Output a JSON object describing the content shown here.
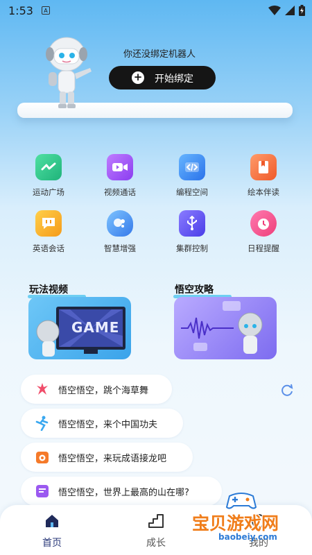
{
  "status_bar": {
    "time": "1:53",
    "a_glyph": "A"
  },
  "header": {
    "hint": "你还没绑定机器人",
    "bind_button": "开始绑定"
  },
  "features": [
    {
      "label": "运动广场",
      "icon": "pulse-icon",
      "color": "#2fc98a"
    },
    {
      "label": "视频通话",
      "icon": "video-icon",
      "color": "#9b59f0"
    },
    {
      "label": "编程空间",
      "icon": "code-icon",
      "color": "#3b8ef5"
    },
    {
      "label": "绘本伴读",
      "icon": "book-icon",
      "color": "#f5693a"
    },
    {
      "label": "英语会话",
      "icon": "chat-icon",
      "color": "#f5a623"
    },
    {
      "label": "智慧增强",
      "icon": "brain-icon",
      "color": "#3b8ef5"
    },
    {
      "label": "集群控制",
      "icon": "usb-icon",
      "color": "#6a5cf5"
    },
    {
      "label": "日程提醒",
      "icon": "alarm-icon",
      "color": "#f04d8a"
    }
  ],
  "sections": {
    "videos_title": "玩法视频",
    "guide_title": "悟空攻略",
    "game_text": "GAME"
  },
  "prompts": [
    {
      "text": "悟空悟空，跳个海草舞",
      "icon": "dance-icon",
      "color": "#f04d6a"
    },
    {
      "text": "悟空悟空，来个中国功夫",
      "icon": "kungfu-icon",
      "color": "#3aa8f0"
    },
    {
      "text": "悟空悟空，来玩成语接龙吧",
      "icon": "idiom-icon",
      "color": "#f57a2a"
    },
    {
      "text": "悟空悟空，世界上最高的山在哪?",
      "icon": "question-icon",
      "color": "#9b59f0"
    }
  ],
  "tabs": [
    {
      "label": "首页",
      "active": true
    },
    {
      "label": "成长",
      "active": false
    },
    {
      "label": "我的",
      "active": false
    }
  ],
  "watermark": {
    "text": "宝贝游戏网",
    "url": "baobeiy.com"
  }
}
